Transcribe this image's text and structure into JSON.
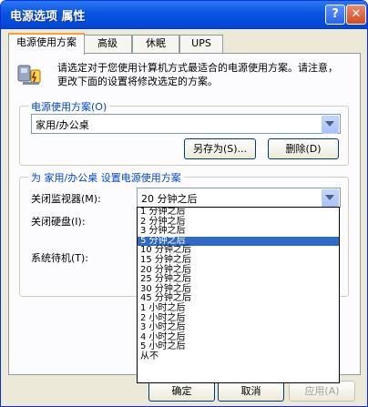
{
  "window": {
    "title": "电源选项 属性",
    "help": "?",
    "close": "✕"
  },
  "tabs": [
    "电源使用方案",
    "高级",
    "休眠",
    "UPS"
  ],
  "description": "请选定对于您使用计算机方式最适合的电源使用方案。请注意，更改下面的设置将修改选定的方案。",
  "scheme_group": {
    "label": "电源使用方案(O)",
    "selected": "家用/办公桌",
    "save_as": "另存为(S)...",
    "delete": "删除(D)"
  },
  "settings_group": {
    "label": "为 家用/办公桌 设置电源使用方案",
    "monitor_label": "关闭监视器(M):",
    "monitor_value": "20 分钟之后",
    "hdd_label": "关闭硬盘(I):",
    "standby_label": "系统待机(T):",
    "options": [
      "1 分钟之后",
      "2 分钟之后",
      "3 分钟之后",
      "5 分钟之后",
      "10 分钟之后",
      "15 分钟之后",
      "20 分钟之后",
      "25 分钟之后",
      "30 分钟之后",
      "45 分钟之后",
      "1 小时之后",
      "2 小时之后",
      "3 小时之后",
      "4 小时之后",
      "5 小时之后",
      "从不"
    ],
    "highlighted_index": 3
  },
  "footer": {
    "ok": "确定",
    "cancel": "取消",
    "apply": "应用(A)"
  },
  "colors": {
    "title_bar": "#0a54e0",
    "highlight": "#316ac5",
    "group_label": "#0046d5"
  }
}
